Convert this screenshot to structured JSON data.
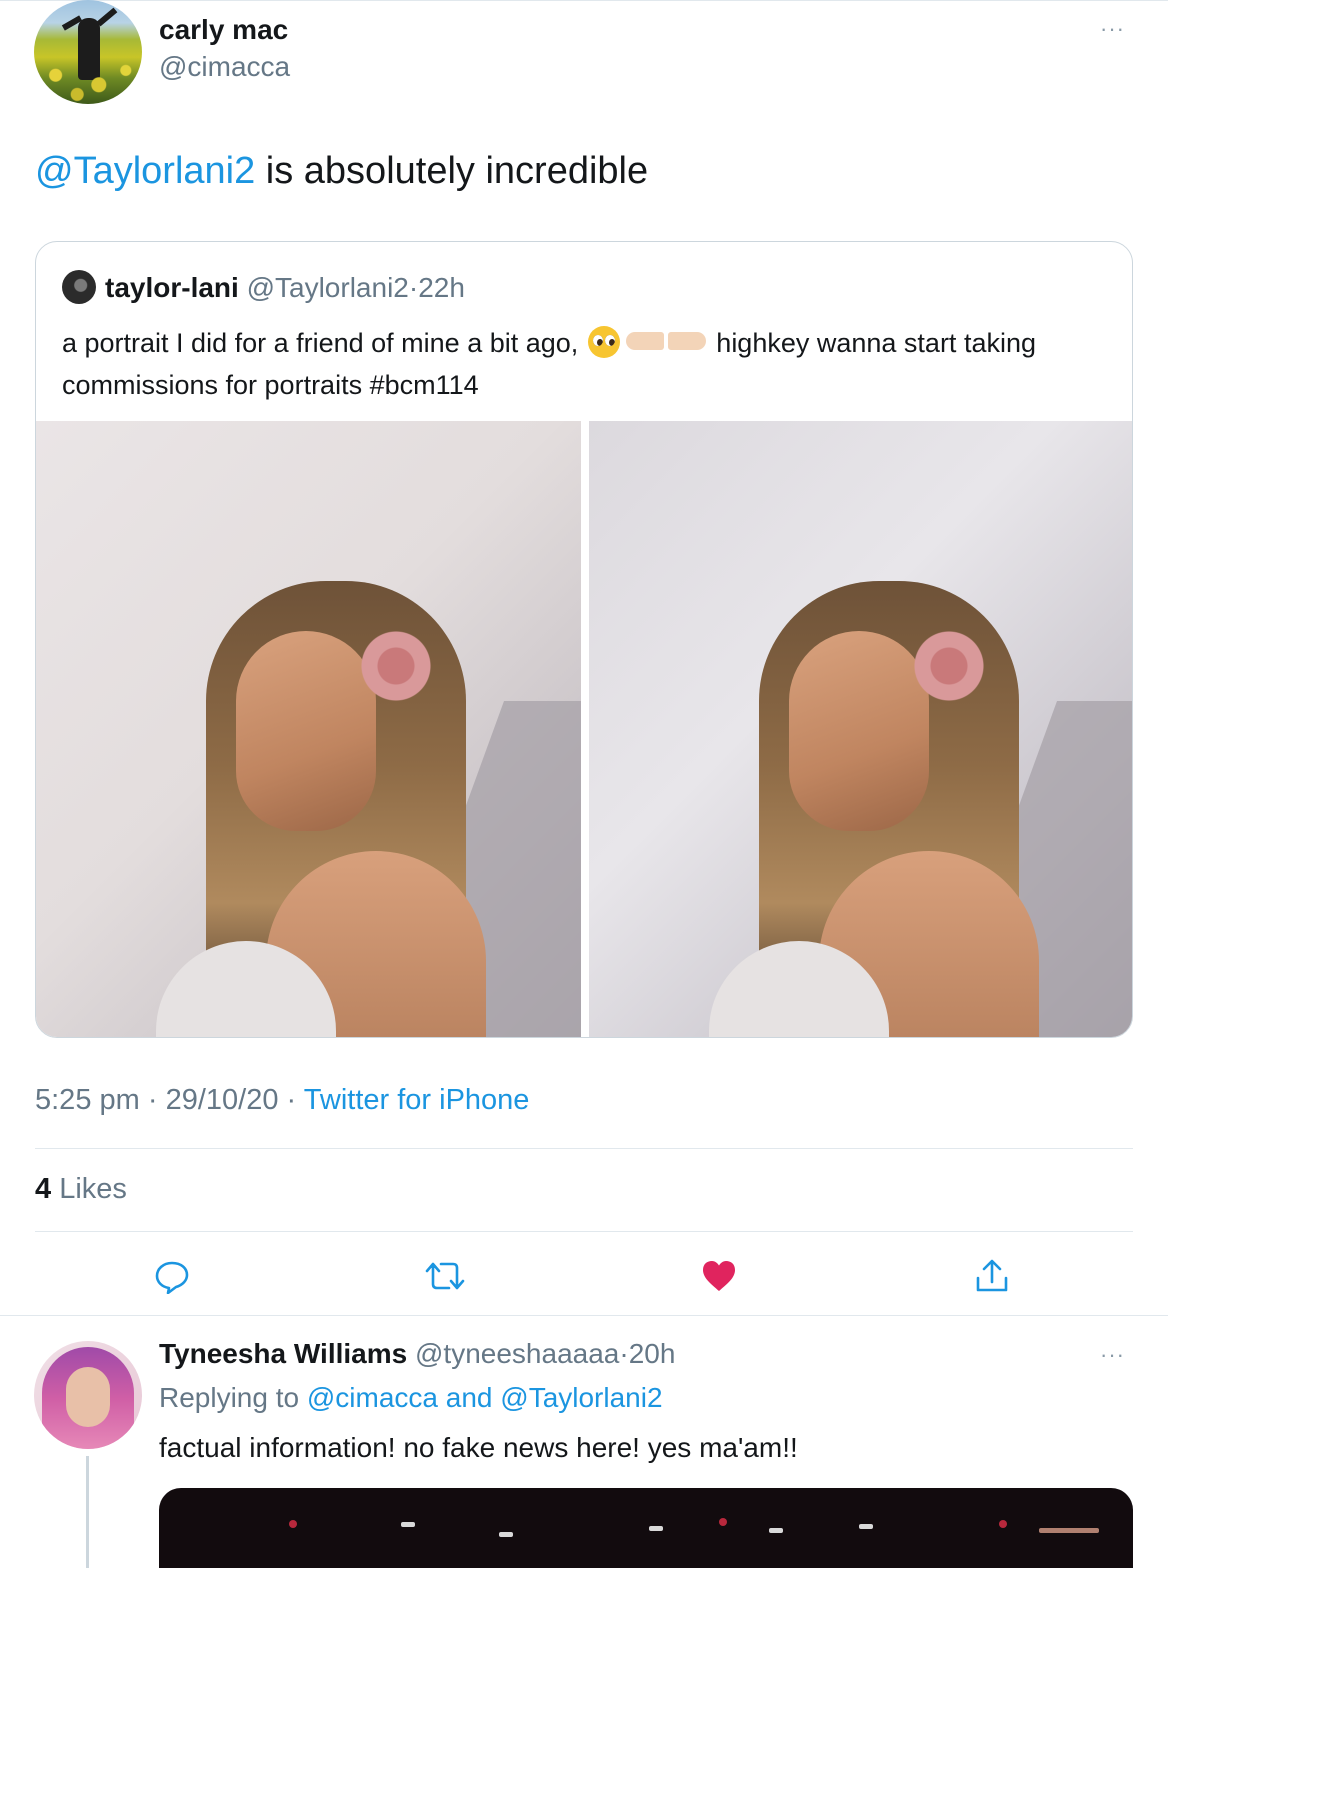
{
  "main_tweet": {
    "author_name": "carly mac",
    "author_handle": "@cimacca",
    "more_label": "···",
    "mention": "@Taylorlani2",
    "text_rest": " is absolutely incredible",
    "timestamp_time": "5:25 pm",
    "timestamp_date": "29/10/20",
    "separator": "·",
    "source": "Twitter for iPhone",
    "likes_count": "4",
    "likes_label": "Likes"
  },
  "quote": {
    "author_name": "taylor-lani",
    "author_handle": "@Taylorlani2",
    "age": "22h",
    "separator": "·",
    "text_part1": "a portrait I did for a friend of mine a bit ago,",
    "text_part2": "highkey wanna start taking commissions for portraits #bcm114",
    "emojis": [
      "pleading-face",
      "pointing-right",
      "pointing-left"
    ]
  },
  "actions": {
    "reply_icon": "reply-icon",
    "retweet_icon": "retweet-icon",
    "like_icon": "heart-icon",
    "share_icon": "share-icon",
    "like_color": "#e0245e",
    "icon_color": "#1b95e0"
  },
  "reply": {
    "author_name": "Tyneesha Williams",
    "author_handle": "@tyneeshaaaaa",
    "separator": "·",
    "age": "20h",
    "more_label": "···",
    "replying_prefix": "Replying to",
    "replying_targets": "@cimacca and @Taylorlani2",
    "text": "factual information! no fake news here! yes ma'am!!"
  },
  "colors": {
    "link": "#1b95e0",
    "secondary_text": "#657786",
    "primary_text": "#14171a",
    "border": "#e1e8ed"
  }
}
